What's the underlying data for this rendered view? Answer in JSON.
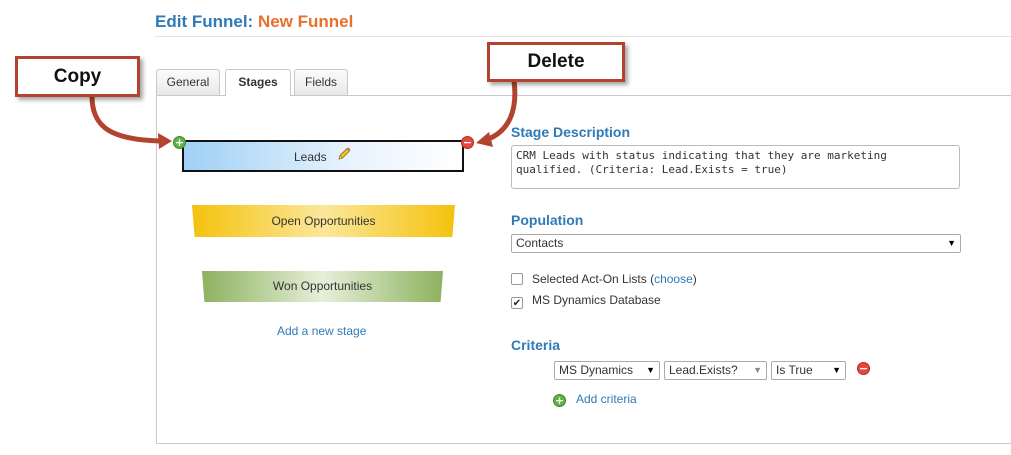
{
  "header": {
    "title_prefix": "Edit Funnel:",
    "funnel_name": "New Funnel"
  },
  "tabs": [
    {
      "label": "General",
      "active": false
    },
    {
      "label": "Stages",
      "active": true
    },
    {
      "label": "Fields",
      "active": false
    }
  ],
  "stages": [
    {
      "label": "Leads",
      "color": "#9fd0f5",
      "selected": true
    },
    {
      "label": "Open Opportunities",
      "color": "#f4c20d",
      "selected": false
    },
    {
      "label": "Won Opportunities",
      "color": "#8db25f",
      "selected": false
    }
  ],
  "add_stage_label": "Add a new stage",
  "annotations": {
    "copy": "Copy",
    "delete": "Delete",
    "color": "#b2432f"
  },
  "stage_description": {
    "label": "Stage Description",
    "value": "CRM Leads with status indicating that they are marketing qualified. (Criteria: Lead.Exists = true)"
  },
  "population": {
    "label": "Population",
    "selected": "Contacts",
    "options": [
      {
        "label": "Selected Act-On Lists",
        "link": "choose",
        "checked": false
      },
      {
        "label": "MS Dynamics Database",
        "checked": true
      }
    ]
  },
  "criteria": {
    "label": "Criteria",
    "rows": [
      {
        "source": "MS Dynamics",
        "field": "Lead.Exists?",
        "operator": "Is True"
      }
    ],
    "add_label": "Add criteria"
  },
  "icons": {
    "copy": "plus-circle-icon",
    "delete": "minus-circle-icon",
    "edit": "pencil-icon",
    "checkbox_checked": "checkmark-icon"
  },
  "colors": {
    "accent_blue": "#2f7ab8",
    "accent_orange": "#e8702a"
  }
}
